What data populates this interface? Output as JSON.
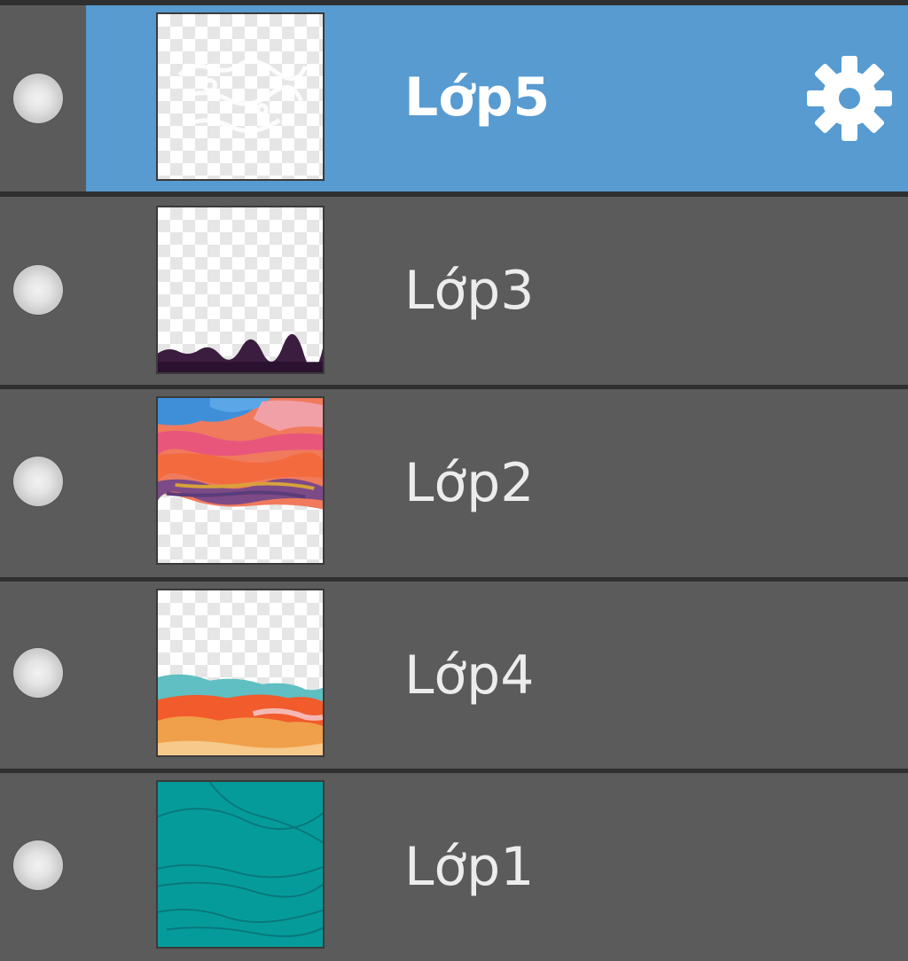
{
  "panel": {
    "layers": [
      {
        "name": "Lớp5",
        "selected": true,
        "thumbnail": "transparent-white-sketch"
      },
      {
        "name": "Lớp3",
        "selected": false,
        "thumbnail": "transparent-dark-ground-strip"
      },
      {
        "name": "Lớp2",
        "selected": false,
        "thumbnail": "sunset-sky-clouds"
      },
      {
        "name": "Lớp4",
        "selected": false,
        "thumbnail": "orange-teal-hills"
      },
      {
        "name": "Lớp1",
        "selected": false,
        "thumbnail": "teal-fill"
      }
    ],
    "settings_icon": "gear-icon",
    "visibility_icon": "visibility-dot-icon"
  },
  "colors": {
    "row_background": "#5b5b5b",
    "selected_background": "#579bd1",
    "separator": "#2f2f2f",
    "label_text": "#ececec",
    "selected_label_text": "#ffffff"
  }
}
